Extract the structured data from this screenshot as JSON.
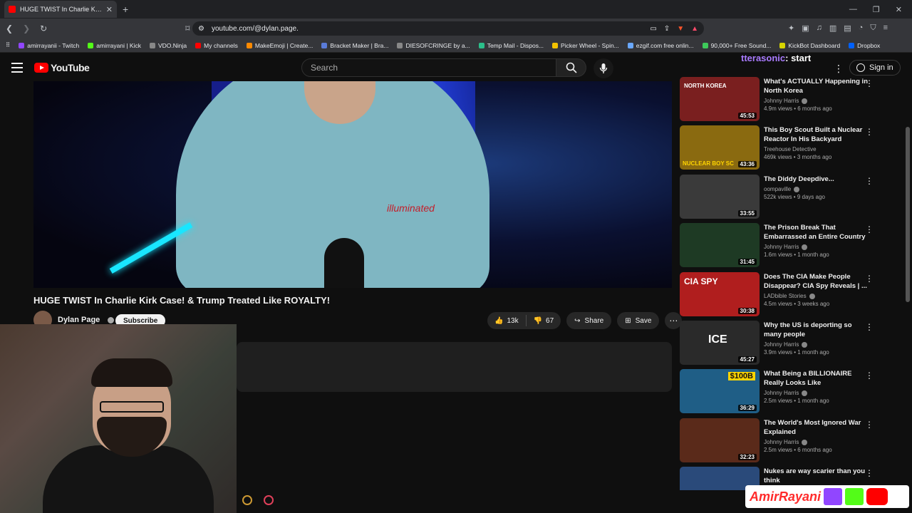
{
  "browser": {
    "tab_title": "HUGE TWIST In Charlie Kirk Case!",
    "url": "youtube.com/@dylan.page.",
    "bookmarks": [
      {
        "label": "amirrayanii - Twitch",
        "color": "#9146ff"
      },
      {
        "label": "amirrayani | Kick",
        "color": "#53fc18"
      },
      {
        "label": "VDO.Ninja",
        "color": "#888888"
      },
      {
        "label": "My channels",
        "color": "#ff0000"
      },
      {
        "label": "MakeEmoji | Create...",
        "color": "#ff8a00"
      },
      {
        "label": "Bracket Maker | Bra...",
        "color": "#5a7bd8"
      },
      {
        "label": "DIESOFCRINGE by a...",
        "color": "#888888"
      },
      {
        "label": "Temp Mail - Dispos...",
        "color": "#2bbf8a"
      },
      {
        "label": "Picker Wheel - Spin...",
        "color": "#f2c200"
      },
      {
        "label": "ezgif.com free onlin...",
        "color": "#6aa8ff"
      },
      {
        "label": "90,000+ Free Sound...",
        "color": "#3ec95a"
      },
      {
        "label": "KickBot Dashboard",
        "color": "#d7d400"
      },
      {
        "label": "Dropbox",
        "color": "#0061fe"
      }
    ]
  },
  "youtube": {
    "logo": "YouTube",
    "search_placeholder": "Search",
    "overlay_user": "tterasonic",
    "overlay_cmd": ": start",
    "sign_in": "Sign in",
    "video_title": "HUGE TWIST In Charlie Kirk Case! & Trump Treated Like ROYALTY!",
    "channel": "Dylan Page",
    "subscribe": "Subscribe",
    "likes": "13k",
    "dislikes": "67",
    "share": "Share",
    "save": "Save"
  },
  "recommendations": [
    {
      "title": "What's ACTUALLY Happening in North Korea",
      "channel": "Johnny Harris",
      "meta": "4.9m views • 6 months ago",
      "duration": "45:53",
      "color": "#7a1f1f"
    },
    {
      "title": "This Boy Scout Built a Nuclear Reactor In His Backyard",
      "channel": "Treehouse Detective",
      "meta": "469k views • 3 months ago",
      "duration": "43:36",
      "color": "#8a6a10"
    },
    {
      "title": "The Diddy Deepdive...",
      "channel": "oompaville",
      "meta": "522k views • 9 days ago",
      "duration": "33:55",
      "color": "#3a3a3a"
    },
    {
      "title": "The Prison Break That Embarrassed an Entire Country",
      "channel": "Johnny Harris",
      "meta": "1.6m views • 1 month ago",
      "duration": "31:45",
      "color": "#1e3a24"
    },
    {
      "title": "Does The CIA Make People Disappear? CIA Spy Reveals | ...",
      "channel": "LADbible Stories",
      "meta": "4.5m views • 3 weeks ago",
      "duration": "30:38",
      "color": "#b01e1e"
    },
    {
      "title": "Why the US is deporting so many people",
      "channel": "Johnny Harris",
      "meta": "3.9m views • 1 month ago",
      "duration": "45:27",
      "color": "#2a2a2a"
    },
    {
      "title": "What Being a BILLIONAIRE Really Looks Like",
      "channel": "Johnny Harris",
      "meta": "2.5m views • 1 month ago",
      "duration": "36:29",
      "color": "#1f5e86"
    },
    {
      "title": "The World's Most Ignored War Explained",
      "channel": "Johnny Harris",
      "meta": "2.5m views • 6 months ago",
      "duration": "32:23",
      "color": "#5a2a1a"
    },
    {
      "title": "Nukes are way scarier than you think",
      "channel": "",
      "meta": "",
      "duration": "",
      "color": "#2a4a7a"
    }
  ],
  "thumb_captions": [
    "NORTH KOREA",
    "NUCLEAR BOY SC",
    "",
    "",
    "CIA SPY",
    "ICE",
    "$100B",
    "",
    ""
  ],
  "banner": {
    "name": "AmirRayani"
  },
  "colors": {
    "accent_red": "#ff0000",
    "link_blue": "#3ea6ff",
    "overlay_purple": "#a97bff"
  }
}
